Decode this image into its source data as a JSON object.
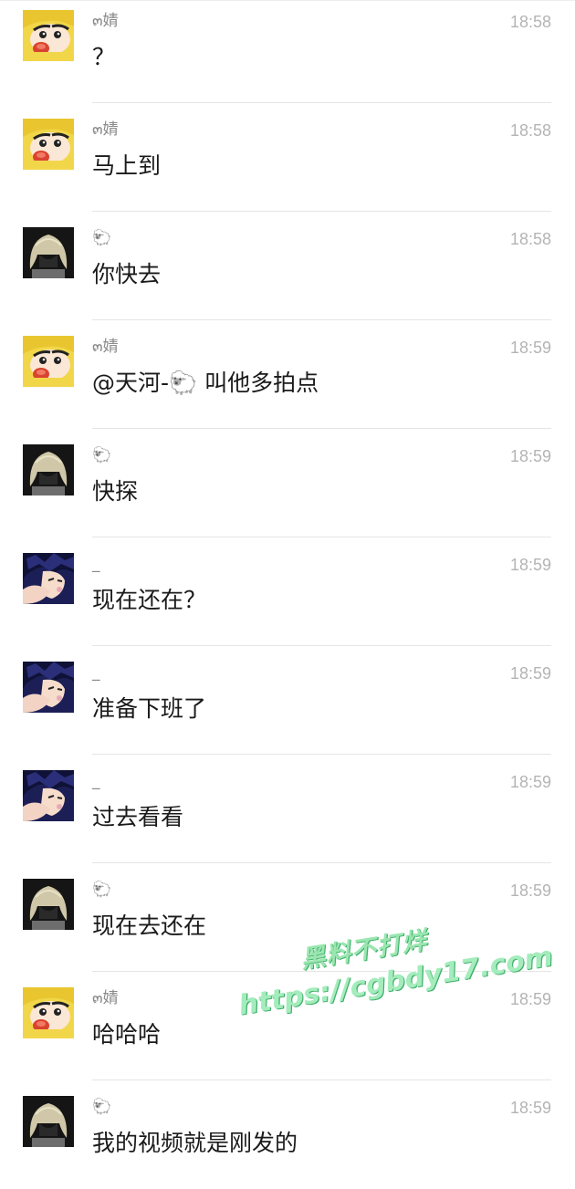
{
  "messages": [
    {
      "avatar": "crayon-shinchan-avatar",
      "sender": "๓婧",
      "time": "18:58",
      "text": "？"
    },
    {
      "avatar": "crayon-shinchan-avatar",
      "sender": "๓婧",
      "time": "18:58",
      "text": "马上到"
    },
    {
      "avatar": "blonde-hair-avatar",
      "sender": "🐑",
      "time": "18:58",
      "text": "你快去"
    },
    {
      "avatar": "crayon-shinchan-avatar",
      "sender": "๓婧",
      "time": "18:59",
      "text": "@天河-🐑 叫他多拍点"
    },
    {
      "avatar": "blonde-hair-avatar",
      "sender": "🐑",
      "time": "18:59",
      "text": "快探"
    },
    {
      "avatar": "anime-boy-avatar",
      "sender": "_",
      "time": "18:59",
      "text": "现在还在？"
    },
    {
      "avatar": "anime-boy-avatar",
      "sender": "_",
      "time": "18:59",
      "text": "准备下班了"
    },
    {
      "avatar": "anime-boy-avatar",
      "sender": "_",
      "time": "18:59",
      "text": "过去看看"
    },
    {
      "avatar": "blonde-hair-avatar",
      "sender": "🐑",
      "time": "18:59",
      "text": "现在去还在"
    },
    {
      "avatar": "crayon-shinchan-avatar",
      "sender": "๓婧",
      "time": "18:59",
      "text": "哈哈哈"
    },
    {
      "avatar": "blonde-hair-avatar",
      "sender": "🐑",
      "time": "18:59",
      "text": "我的视频就是刚发的"
    }
  ],
  "watermark": {
    "line1": "黑料不打烊",
    "line2": "https://cgbdy17.com"
  },
  "colors": {
    "time": "#b4b4b4",
    "sender": "#8a8a8a",
    "text": "#1a1a1a",
    "divider": "#e5e5e5",
    "watermark": "#9be6b0"
  }
}
